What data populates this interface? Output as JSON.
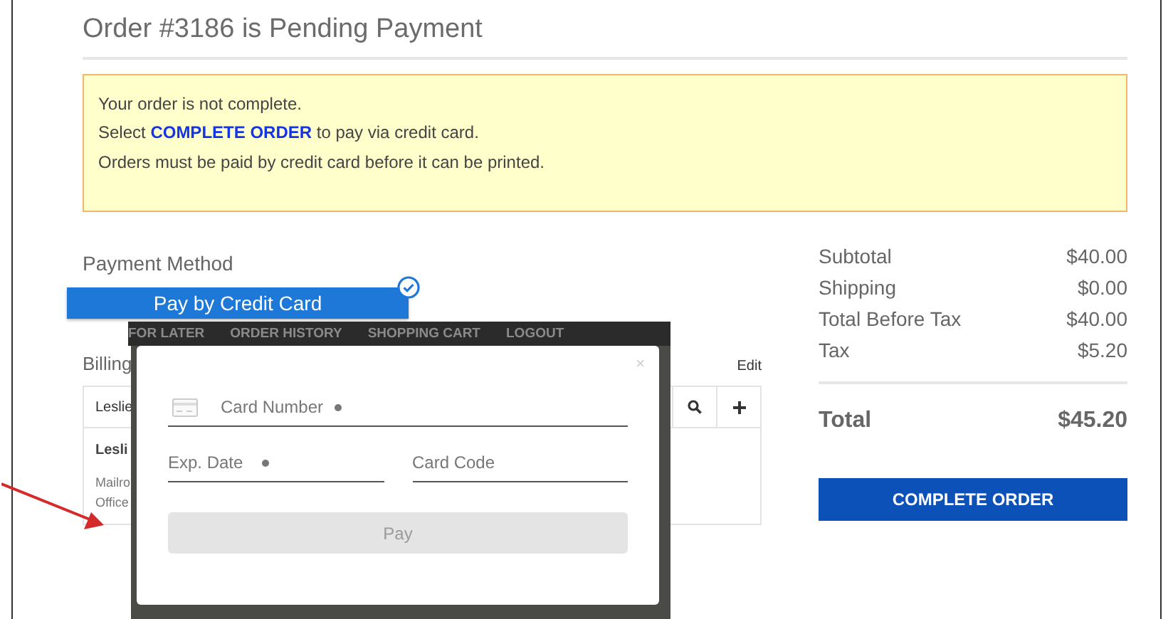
{
  "page_title": "Order #3186 is Pending Payment",
  "notice": {
    "lines": [
      "Your order is not complete.",
      "Select **COMPLETE ORDER** to pay via credit card.",
      "Orders must be paid by credit card before it can be printed."
    ]
  },
  "payment_method": {
    "heading": "Payment Method",
    "option": {
      "label": "Pay by Credit Card",
      "selected": true
    }
  },
  "billing": {
    "heading": "Billing",
    "edit_link": "Edit",
    "address_select": "Leslie",
    "name": "Lesli",
    "lines": [
      "Mailro",
      "Office"
    ]
  },
  "summary": {
    "rows": [
      {
        "label": "Subtotal",
        "value": "$40.00"
      },
      {
        "label": "Shipping",
        "value": "$0.00"
      },
      {
        "label": "Total Before Tax",
        "value": "$40.00"
      },
      {
        "label": "Tax",
        "value": "$5.20"
      }
    ],
    "total": {
      "label": "Total",
      "value": "$45.20"
    },
    "button": "COMPLETE ORDER"
  },
  "payment_popup": {
    "nav": [
      "FOR LATER",
      "ORDER HISTORY",
      "SHOPPING CART",
      "LOGOUT"
    ],
    "close": "×",
    "fields": [
      {
        "kind": "card",
        "placeholder": "Card Number",
        "required": true
      },
      {
        "kind": "plain",
        "placeholder": "Exp. Date",
        "required": true
      },
      {
        "kind": "plain",
        "placeholder": "Card Code",
        "required": false
      }
    ],
    "button": {
      "label": "Pay",
      "disabled": true
    }
  }
}
